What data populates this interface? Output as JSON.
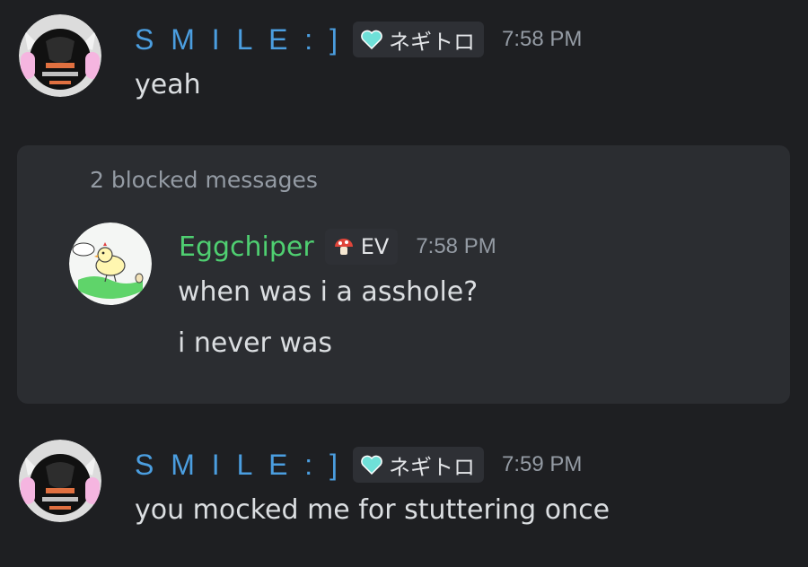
{
  "messages": [
    {
      "author": "S M I L E : ]",
      "author_color": "#4b9ee0",
      "role_tag": "ネギトロ",
      "role_icon": "teal-heart-icon",
      "time": "7:58 PM",
      "text": "yeah"
    },
    {
      "author": "S M I L E : ]",
      "author_color": "#4b9ee0",
      "role_tag": "ネギトロ",
      "role_icon": "teal-heart-icon",
      "time": "7:59 PM",
      "text": "you mocked me for stuttering once"
    }
  ],
  "blocked": {
    "label": "2 blocked messages",
    "message": {
      "author": "Eggchiper",
      "author_color": "#4fcf71",
      "role_tag": "EV",
      "role_icon": "mushroom-icon",
      "time": "7:58 PM",
      "lines": [
        "when was i a asshole?",
        "i never was"
      ]
    }
  },
  "colors": {
    "background": "#1e1f22",
    "blocked_background": "#2b2d31",
    "timestamp": "#949ba4",
    "tag_background": "#2e3035"
  }
}
